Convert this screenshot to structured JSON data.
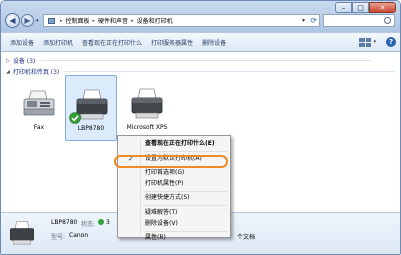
{
  "window": {
    "caption_buttons": {
      "minimize": "–",
      "maximize": "□",
      "close": "✕"
    }
  },
  "nav": {
    "back_glyph": "◀",
    "forward_glyph": "▶",
    "dropdown_glyph": "▾"
  },
  "address": {
    "breadcrumbs": [
      "控制面板",
      "硬件和声音",
      "设备和打印机"
    ],
    "separator": "▸",
    "dropdown_glyph": "▾",
    "refresh_glyph": "⟳"
  },
  "search": {
    "placeholder": ""
  },
  "commandbar": {
    "items": [
      "添加设备",
      "添加打印机",
      "查看现在正在打印什么",
      "打印服务器属性",
      "删除设备"
    ],
    "view_dropdown": "▾",
    "help": "?"
  },
  "groups": {
    "devices": {
      "expander": "▷",
      "title": "设备 (3)"
    },
    "printers": {
      "expander": "◢",
      "title": "打印机和传真 (3)"
    }
  },
  "printers": [
    {
      "label": "Fax"
    },
    {
      "label": "LBP8780"
    },
    {
      "label": "Microsoft XPS"
    }
  ],
  "context_menu": {
    "items": [
      {
        "label": "查看现在正在打印什么(E)",
        "bold": true
      },
      {
        "label": "设置为默认打印机(A)",
        "checked": true,
        "check_glyph": "✓"
      },
      {
        "label": "打印首选项(G)",
        "highlighted": true
      },
      {
        "label": "打印机属性(P)"
      },
      {
        "label": "创建快捷方式(S)"
      },
      {
        "label": "疑难解答(T)"
      },
      {
        "label": "删除设备(V)"
      },
      {
        "label": "属性(R)"
      }
    ],
    "highlight_color": "#f08a23"
  },
  "details": {
    "name": "LBP8780",
    "status_key": "状态:",
    "status_value": "3",
    "model_key": "型号:",
    "model_value": "Canon",
    "right_fragment": "个文档"
  },
  "colors": {
    "accent": "#2a62b1",
    "selection": "#dcebfc",
    "ok_badge": "#35a03a"
  }
}
